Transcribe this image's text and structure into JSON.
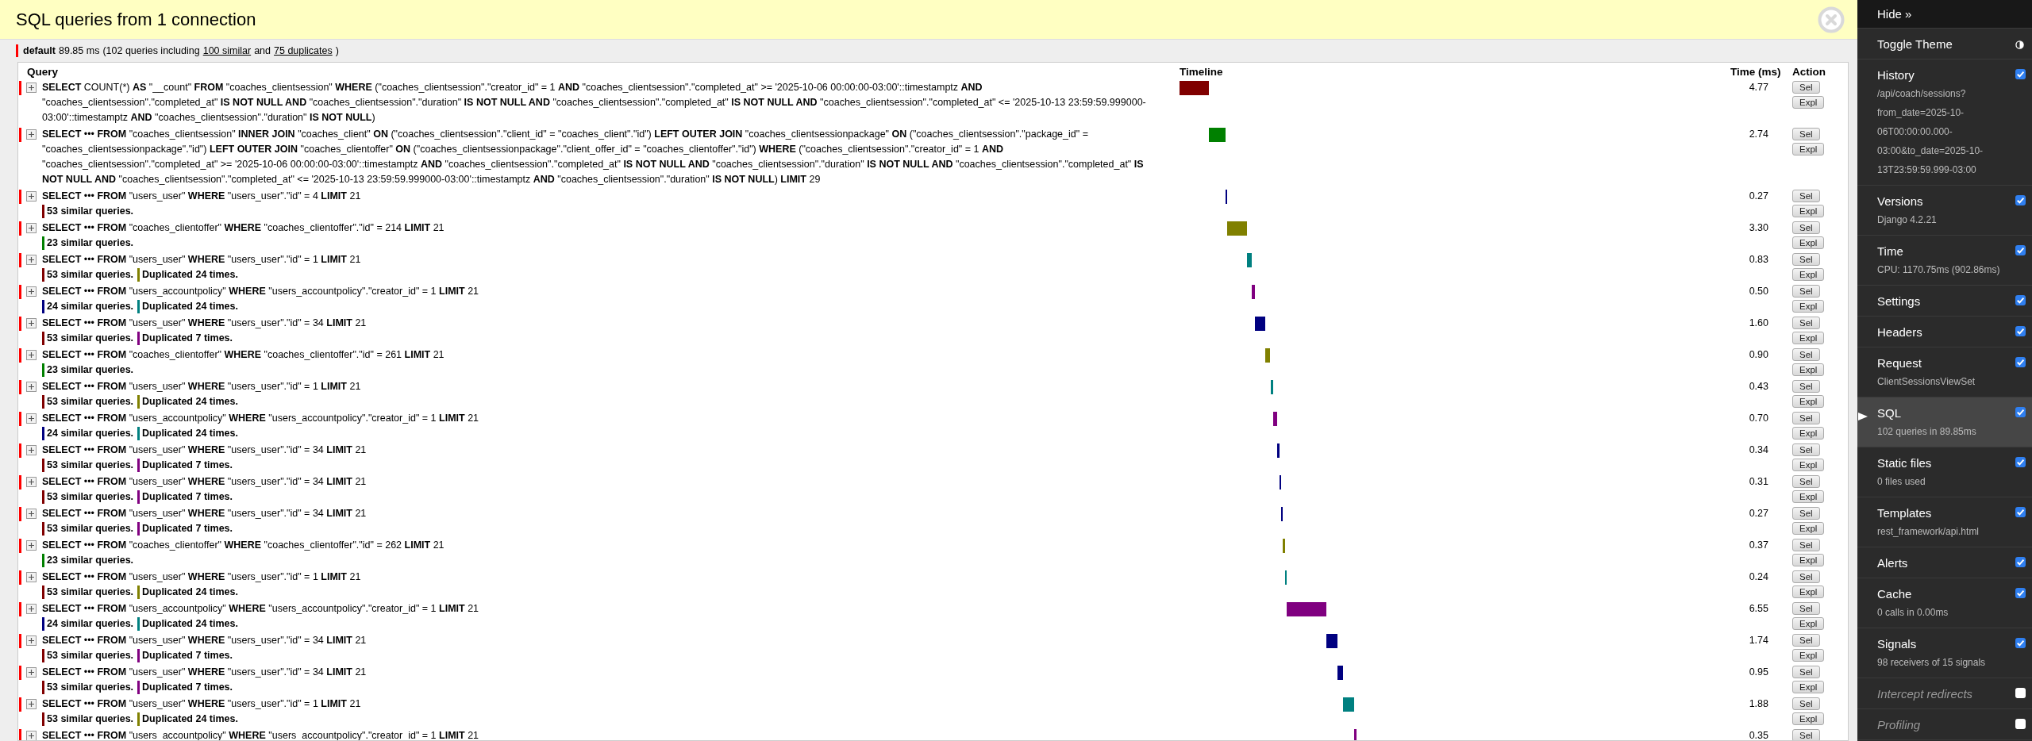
{
  "header": {
    "title": "SQL queries from 1 connection"
  },
  "connection": {
    "color": "#ff0000",
    "alias": "default",
    "time": "89.85 ms",
    "summary_start": "(102 queries including",
    "similar_link": "100 similar",
    "joiner": "and",
    "duplicates_link": "75 duplicates",
    "summary_end": ")"
  },
  "queries": {
    "columns": [
      "Query",
      "Timeline",
      "Time (ms)",
      "Action"
    ],
    "rows": [
      {
        "query": "**SELECT** COUNT(*) **AS** \"__count\" **FROM** \"coaches_clientsession\" **WHERE** (\"coaches_clientsession\".\"creator_id\" = 1 **AND** \"coaches_clientsession\".\"completed_at\" >= '2025-10-06 00:00:00-03:00'::timestamptz **AND** \"coaches_clientsession\".\"completed_at\" **IS NOT NULL AND** \"coaches_clientsession\".\"duration\" **IS NOT NULL AND** \"coaches_clientsession\".\"completed_at\" **IS NOT NULL AND** \"coaches_clientsession\".\"completed_at\" <= '2025-10-13 23:59:59.999000-03:00'::timestamptz **AND** \"coaches_clientsession\".\"duration\" **IS NOT NULL**)",
        "notes": [],
        "time": "4.77",
        "color": "#800000",
        "actions": [
          "Sel",
          "Expl"
        ]
      },
      {
        "query": "**SELECT** ••• **FROM** \"coaches_clientsession\" **INNER JOIN** \"coaches_client\" **ON** (\"coaches_clientsession\".\"client_id\" = \"coaches_client\".\"id\") **LEFT OUTER JOIN** \"coaches_clientsessionpackage\" **ON** (\"coaches_clientsession\".\"package_id\" = \"coaches_clientsessionpackage\".\"id\") **LEFT OUTER JOIN** \"coaches_clientoffer\" **ON** (\"coaches_clientsessionpackage\".\"client_offer_id\" = \"coaches_clientoffer\".\"id\") **WHERE** (\"coaches_clientsession\".\"creator_id\" = 1 **AND** \"coaches_clientsession\".\"completed_at\" >= '2025-10-06 00:00:00-03:00'::timestamptz **AND** \"coaches_clientsession\".\"completed_at\" **IS NOT NULL AND** \"coaches_clientsession\".\"duration\" **IS NOT NULL AND** \"coaches_clientsession\".\"completed_at\" **IS NOT NULL AND** \"coaches_clientsession\".\"completed_at\" <= '2025-10-13 23:59:59.999000-03:00'::timestamptz **AND** \"coaches_clientsession\".\"duration\" **IS NOT NULL**) **LIMIT** 29",
        "notes": [],
        "time": "2.74",
        "color": "#008000",
        "actions": [
          "Sel",
          "Expl"
        ]
      },
      {
        "query": "**SELECT** ••• **FROM** \"users_user\" **WHERE** \"users_user\".\"id\" = 4 **LIMIT** 21",
        "notes": [
          {
            "text": "53 similar queries.",
            "color": "#800000"
          }
        ],
        "time": "0.27",
        "color": "#000080",
        "actions": [
          "Sel",
          "Expl"
        ]
      },
      {
        "query": "**SELECT** ••• **FROM** \"coaches_clientoffer\" **WHERE** \"coaches_clientoffer\".\"id\" = 214 **LIMIT** 21",
        "notes": [
          {
            "text": "23 similar queries.",
            "color": "#008000"
          }
        ],
        "time": "3.30",
        "color": "#808000",
        "actions": [
          "Sel",
          "Expl"
        ]
      },
      {
        "query": "**SELECT** ••• **FROM** \"users_user\" **WHERE** \"users_user\".\"id\" = 1 **LIMIT** 21",
        "notes": [
          {
            "text": "53 similar queries.",
            "color": "#800000"
          },
          {
            "text": "Duplicated 24 times.",
            "color": "#808000"
          }
        ],
        "time": "0.83",
        "color": "#008080",
        "actions": [
          "Sel",
          "Expl"
        ]
      },
      {
        "query": "**SELECT** ••• **FROM** \"users_accountpolicy\" **WHERE** \"users_accountpolicy\".\"creator_id\" = 1 **LIMIT** 21",
        "notes": [
          {
            "text": "24 similar queries.",
            "color": "#000080"
          },
          {
            "text": "Duplicated 24 times.",
            "color": "#008080"
          }
        ],
        "time": "0.50",
        "color": "#800080",
        "actions": [
          "Sel",
          "Expl"
        ]
      },
      {
        "query": "**SELECT** ••• **FROM** \"users_user\" **WHERE** \"users_user\".\"id\" = 34 **LIMIT** 21",
        "notes": [
          {
            "text": "53 similar queries.",
            "color": "#800000"
          },
          {
            "text": "Duplicated 7 times.",
            "color": "#800080"
          }
        ],
        "time": "1.60",
        "color": "#000080",
        "actions": [
          "Sel",
          "Expl"
        ]
      },
      {
        "query": "**SELECT** ••• **FROM** \"coaches_clientoffer\" **WHERE** \"coaches_clientoffer\".\"id\" = 261 **LIMIT** 21",
        "notes": [
          {
            "text": "23 similar queries.",
            "color": "#008000"
          }
        ],
        "time": "0.90",
        "color": "#808000",
        "actions": [
          "Sel",
          "Expl"
        ]
      },
      {
        "query": "**SELECT** ••• **FROM** \"users_user\" **WHERE** \"users_user\".\"id\" = 1 **LIMIT** 21",
        "notes": [
          {
            "text": "53 similar queries.",
            "color": "#800000"
          },
          {
            "text": "Duplicated 24 times.",
            "color": "#808000"
          }
        ],
        "time": "0.43",
        "color": "#008080",
        "actions": [
          "Sel",
          "Expl"
        ]
      },
      {
        "query": "**SELECT** ••• **FROM** \"users_accountpolicy\" **WHERE** \"users_accountpolicy\".\"creator_id\" = 1 **LIMIT** 21",
        "notes": [
          {
            "text": "24 similar queries.",
            "color": "#000080"
          },
          {
            "text": "Duplicated 24 times.",
            "color": "#008080"
          }
        ],
        "time": "0.70",
        "color": "#800080",
        "actions": [
          "Sel",
          "Expl"
        ]
      },
      {
        "query": "**SELECT** ••• **FROM** \"users_user\" **WHERE** \"users_user\".\"id\" = 34 **LIMIT** 21",
        "notes": [
          {
            "text": "53 similar queries.",
            "color": "#800000"
          },
          {
            "text": "Duplicated 7 times.",
            "color": "#800080"
          }
        ],
        "time": "0.34",
        "color": "#000080",
        "actions": [
          "Sel",
          "Expl"
        ]
      },
      {
        "query": "**SELECT** ••• **FROM** \"users_user\" **WHERE** \"users_user\".\"id\" = 34 **LIMIT** 21",
        "notes": [
          {
            "text": "53 similar queries.",
            "color": "#800000"
          },
          {
            "text": "Duplicated 7 times.",
            "color": "#800080"
          }
        ],
        "time": "0.31",
        "color": "#000080",
        "actions": [
          "Sel",
          "Expl"
        ]
      },
      {
        "query": "**SELECT** ••• **FROM** \"users_user\" **WHERE** \"users_user\".\"id\" = 34 **LIMIT** 21",
        "notes": [
          {
            "text": "53 similar queries.",
            "color": "#800000"
          },
          {
            "text": "Duplicated 7 times.",
            "color": "#800080"
          }
        ],
        "time": "0.27",
        "color": "#000080",
        "actions": [
          "Sel",
          "Expl"
        ]
      },
      {
        "query": "**SELECT** ••• **FROM** \"coaches_clientoffer\" **WHERE** \"coaches_clientoffer\".\"id\" = 262 **LIMIT** 21",
        "notes": [
          {
            "text": "23 similar queries.",
            "color": "#008000"
          }
        ],
        "time": "0.37",
        "color": "#808000",
        "actions": [
          "Sel",
          "Expl"
        ]
      },
      {
        "query": "**SELECT** ••• **FROM** \"users_user\" **WHERE** \"users_user\".\"id\" = 1 **LIMIT** 21",
        "notes": [
          {
            "text": "53 similar queries.",
            "color": "#800000"
          },
          {
            "text": "Duplicated 24 times.",
            "color": "#808000"
          }
        ],
        "time": "0.24",
        "color": "#008080",
        "actions": [
          "Sel",
          "Expl"
        ]
      },
      {
        "query": "**SELECT** ••• **FROM** \"users_accountpolicy\" **WHERE** \"users_accountpolicy\".\"creator_id\" = 1 **LIMIT** 21",
        "notes": [
          {
            "text": "24 similar queries.",
            "color": "#000080"
          },
          {
            "text": "Duplicated 24 times.",
            "color": "#008080"
          }
        ],
        "time": "6.55",
        "color": "#800080",
        "actions": [
          "Sel",
          "Expl"
        ]
      },
      {
        "query": "**SELECT** ••• **FROM** \"users_user\" **WHERE** \"users_user\".\"id\" = 34 **LIMIT** 21",
        "notes": [
          {
            "text": "53 similar queries.",
            "color": "#800000"
          },
          {
            "text": "Duplicated 7 times.",
            "color": "#800080"
          }
        ],
        "time": "1.74",
        "color": "#000080",
        "actions": [
          "Sel",
          "Expl"
        ]
      },
      {
        "query": "**SELECT** ••• **FROM** \"users_user\" **WHERE** \"users_user\".\"id\" = 34 **LIMIT** 21",
        "notes": [
          {
            "text": "53 similar queries.",
            "color": "#800000"
          },
          {
            "text": "Duplicated 7 times.",
            "color": "#800080"
          }
        ],
        "time": "0.95",
        "color": "#000080",
        "actions": [
          "Sel",
          "Expl"
        ]
      },
      {
        "query": "**SELECT** ••• **FROM** \"users_user\" **WHERE** \"users_user\".\"id\" = 1 **LIMIT** 21",
        "notes": [
          {
            "text": "53 similar queries.",
            "color": "#800000"
          },
          {
            "text": "Duplicated 24 times.",
            "color": "#808000"
          }
        ],
        "time": "1.88",
        "color": "#008080",
        "actions": [
          "Sel",
          "Expl"
        ]
      },
      {
        "query": "**SELECT** ••• **FROM** \"users_accountpolicy\" **WHERE** \"users_accountpolicy\".\"creator_id\" = 1 **LIMIT** 21",
        "notes": [],
        "time": "0.35",
        "color": "#800080",
        "actions": [
          "Sel"
        ]
      }
    ]
  },
  "toolbar": {
    "hide": "Hide »",
    "theme": "Toggle Theme",
    "panels": [
      {
        "title": "History",
        "subtitle": "/api/coach/sessions?from_date=2025-10-06T00:00:00.000-03:00&to_date=2025-10-13T23:59:59.999-03:00",
        "checked": true,
        "selected": false
      },
      {
        "title": "Versions",
        "subtitle": "Django 4.2.21",
        "checked": true,
        "selected": false
      },
      {
        "title": "Time",
        "subtitle": "CPU: 1170.75ms (902.86ms)",
        "checked": true,
        "selected": false
      },
      {
        "title": "Settings",
        "checked": true,
        "selected": false
      },
      {
        "title": "Headers",
        "checked": true,
        "selected": false
      },
      {
        "title": "Request",
        "subtitle": "ClientSessionsViewSet",
        "checked": true,
        "selected": false
      },
      {
        "title": "SQL",
        "subtitle": "102 queries in 89.85ms",
        "checked": true,
        "selected": true
      },
      {
        "title": "Static files",
        "subtitle": "0 files used",
        "checked": true,
        "selected": false
      },
      {
        "title": "Templates",
        "subtitle": "rest_framework/api.html",
        "checked": true,
        "selected": false
      },
      {
        "title": "Alerts",
        "checked": true,
        "selected": false
      },
      {
        "title": "Cache",
        "subtitle": "0 calls in 0.00ms",
        "checked": true,
        "selected": false
      },
      {
        "title": "Signals",
        "subtitle": "98 receivers of 15 signals",
        "checked": true,
        "selected": false
      },
      {
        "title": "Intercept redirects",
        "checked": false,
        "selected": false
      },
      {
        "title": "Profiling",
        "checked": false,
        "selected": false
      }
    ]
  }
}
